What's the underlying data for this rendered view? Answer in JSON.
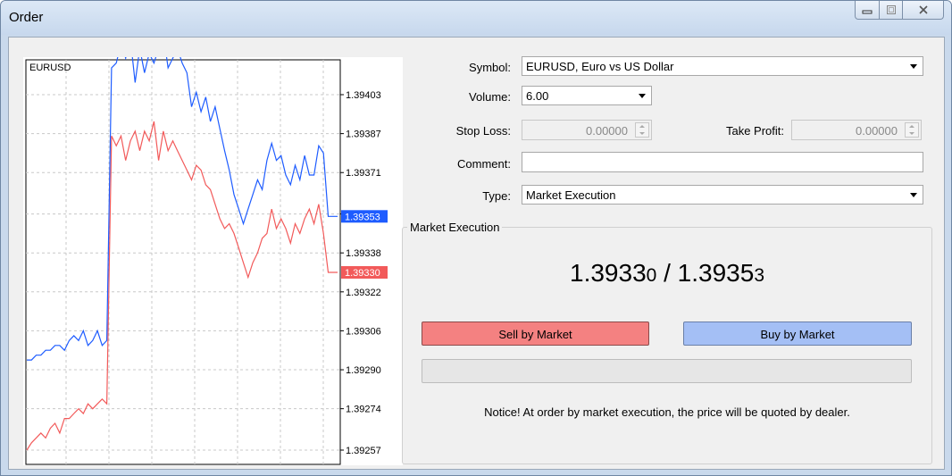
{
  "window": {
    "title": "Order"
  },
  "chart": {
    "symbol_label": "EURUSD",
    "y_ticks": [
      "1.39403",
      "1.39387",
      "1.39371",
      "1.39354",
      "1.39338",
      "1.39322",
      "1.39306",
      "1.39290",
      "1.39274",
      "1.39257"
    ],
    "y_tick_values": [
      1.39403,
      1.39387,
      1.39371,
      1.39354,
      1.39338,
      1.39322,
      1.39306,
      1.3929,
      1.39274,
      1.39257
    ],
    "ask_badge": "1.39353",
    "ask_value": 1.39353,
    "bid_badge": "1.39330",
    "bid_value": 1.3933,
    "ask_color": "#1e5cff",
    "bid_color": "#f25a5a",
    "ask_series": [
      1.39294,
      1.39294,
      1.39296,
      1.39296,
      1.39298,
      1.39298,
      1.393,
      1.393,
      1.39298,
      1.39302,
      1.39304,
      1.39302,
      1.39306,
      1.393,
      1.39302,
      1.39306,
      1.393,
      1.39302,
      1.39414,
      1.39416,
      1.39424,
      1.39418,
      1.39426,
      1.39408,
      1.39422,
      1.39412,
      1.3942,
      1.39416,
      1.39422,
      1.39428,
      1.39414,
      1.39418,
      1.39422,
      1.39416,
      1.39412,
      1.39398,
      1.39404,
      1.39396,
      1.39402,
      1.39392,
      1.39398,
      1.39389,
      1.3938,
      1.39372,
      1.39362,
      1.39356,
      1.3935,
      1.39356,
      1.39362,
      1.39368,
      1.39364,
      1.39376,
      1.39383,
      1.39376,
      1.39378,
      1.3937,
      1.39366,
      1.39374,
      1.39368,
      1.39378,
      1.3937,
      1.3937,
      1.39382,
      1.39379,
      1.39353,
      1.39353,
      1.39353
    ],
    "bid_series": [
      1.39257,
      1.3926,
      1.39262,
      1.39264,
      1.39262,
      1.39266,
      1.39268,
      1.39264,
      1.3927,
      1.3927,
      1.39272,
      1.39274,
      1.39272,
      1.39276,
      1.39274,
      1.39276,
      1.39278,
      1.39276,
      1.39386,
      1.39382,
      1.39386,
      1.39376,
      1.39384,
      1.39388,
      1.3938,
      1.39388,
      1.39384,
      1.39392,
      1.39376,
      1.39388,
      1.3938,
      1.39384,
      1.3938,
      1.39376,
      1.39372,
      1.39368,
      1.39374,
      1.39372,
      1.39366,
      1.39364,
      1.39358,
      1.39352,
      1.39348,
      1.3935,
      1.39346,
      1.3934,
      1.39334,
      1.39328,
      1.39334,
      1.39338,
      1.39344,
      1.39346,
      1.39356,
      1.39348,
      1.39352,
      1.39348,
      1.39342,
      1.3935,
      1.39346,
      1.39352,
      1.39356,
      1.3935,
      1.39358,
      1.39346,
      1.3933,
      1.3933,
      1.3933
    ]
  },
  "form": {
    "symbol_label": "Symbol:",
    "symbol_value": "EURUSD, Euro vs US Dollar",
    "volume_label": "Volume:",
    "volume_value": "6.00",
    "stoploss_label": "Stop Loss:",
    "stoploss_value": "0.00000",
    "takeprofit_label": "Take Profit:",
    "takeprofit_value": "0.00000",
    "comment_label": "Comment:",
    "comment_value": "",
    "type_label": "Type:",
    "type_value": "Market Execution"
  },
  "market": {
    "group_title": "Market Execution",
    "bid_main": "1.3933",
    "bid_small": "0",
    "separator": " / ",
    "ask_main": "1.3935",
    "ask_small": "3",
    "sell_label": "Sell by Market",
    "buy_label": "Buy by Market",
    "notice": "Notice! At order by market execution, the price will be quoted by dealer."
  },
  "colors": {
    "sell_button": "#f48181",
    "buy_button": "#a4bff5"
  }
}
